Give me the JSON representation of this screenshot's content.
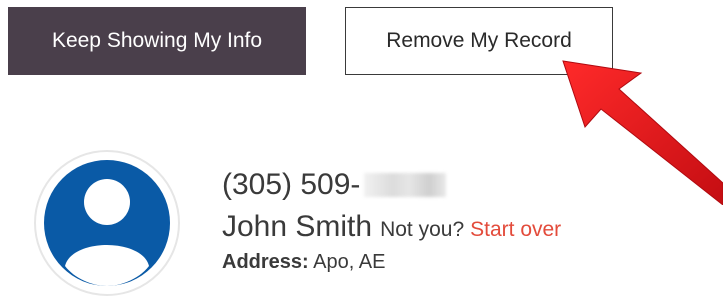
{
  "actions": {
    "keep_label": "Keep Showing My Info",
    "remove_label": "Remove My Record"
  },
  "record": {
    "phone_visible": "(305) 509-",
    "name": "John Smith",
    "not_you": "Not you?",
    "start_over": "Start over",
    "address_label": "Address:",
    "address_value": "Apo, AE"
  },
  "icons": {
    "avatar": "user-avatar-icon",
    "annotation": "red-arrow-icon"
  },
  "colors": {
    "keep_button_bg": "#4a3f4b",
    "avatar_blue": "#0a5aa6",
    "link_red": "#e34b3b",
    "arrow_red": "#e0141b"
  }
}
